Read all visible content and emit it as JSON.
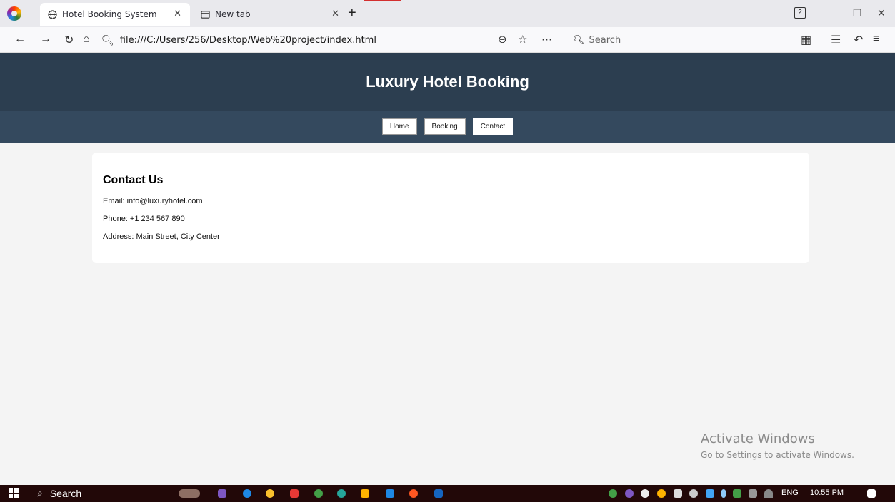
{
  "browser": {
    "tabs": [
      {
        "title": "Hotel Booking System",
        "active": true
      },
      {
        "title": "New tab",
        "active": false
      }
    ],
    "tab_count": "2",
    "url": "file:///C:/Users/256/Desktop/Web%20project/index.html",
    "search_placeholder": "Search"
  },
  "site": {
    "title": "Luxury Hotel Booking",
    "nav": [
      "Home",
      "Booking",
      "Contact"
    ],
    "selected_nav": "Contact"
  },
  "contact": {
    "heading": "Contact Us",
    "email": "Email: info@luxuryhotel.com",
    "phone": "Phone: +1 234 567 890",
    "address": "Address: Main Street, City Center"
  },
  "watermark": {
    "title": "Activate Windows",
    "subtitle": "Go to Settings to activate Windows."
  },
  "taskbar": {
    "search_label": "Search",
    "language": "ENG",
    "time": "10:55 PM"
  },
  "colors": {
    "header": "#2c3e50",
    "nav": "#34495e",
    "page_bg": "#f4f4f4",
    "taskbar": "#220808"
  }
}
